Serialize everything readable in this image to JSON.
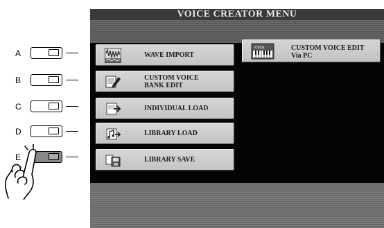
{
  "screen": {
    "title": "VOICE CREATOR MENU"
  },
  "panel": {
    "buttons": [
      {
        "letter": "A",
        "pressed": false
      },
      {
        "letter": "B",
        "pressed": false
      },
      {
        "letter": "C",
        "pressed": false
      },
      {
        "letter": "D",
        "pressed": false
      },
      {
        "letter": "E",
        "pressed": true
      }
    ]
  },
  "menu": {
    "items": [
      {
        "label": "WAVE IMPORT",
        "icon": "wave-icon"
      },
      {
        "label": "CUSTOM VOICE\nBANK EDIT",
        "icon": "bank-edit-icon"
      },
      {
        "label": "INDIVIDUAL LOAD",
        "icon": "individual-load-icon"
      },
      {
        "label": "LIBRARY LOAD",
        "icon": "library-load-icon"
      },
      {
        "label": "LIBRARY SAVE",
        "icon": "library-save-icon"
      }
    ],
    "pc_item": {
      "line1": "CUSTOM VOICE EDIT",
      "line2": "Via PC",
      "icon_text": "VOICE",
      "icon": "voice-keyboard-icon"
    }
  },
  "colors": {
    "screen_title_bg": "#3a3a3a",
    "screen_black": "#050505",
    "menu_item_bg": "#c8c8c8"
  }
}
